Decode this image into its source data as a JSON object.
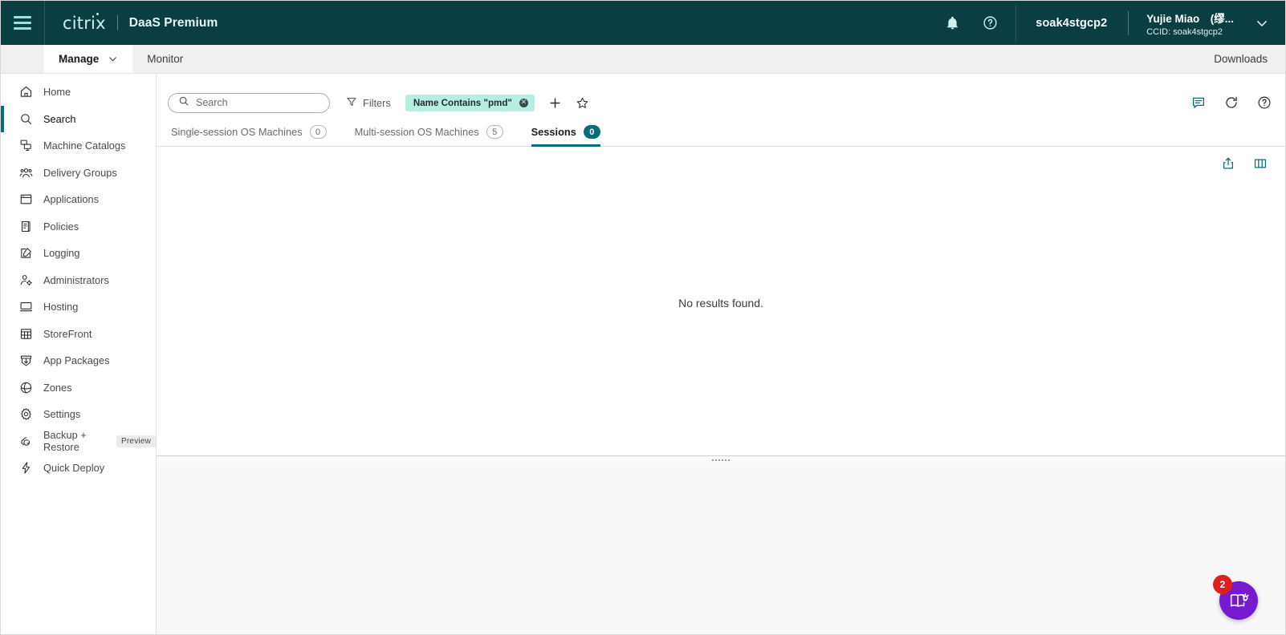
{
  "header": {
    "menu_icon": "hamburger-menu-icon",
    "logo_text": "citrix",
    "product_name": "DaaS Premium",
    "notifications_icon": "bell-icon",
    "help_icon": "help-circle-icon",
    "customer_name": "soak4stgcp2",
    "user_name": "Yujie Miao　(缪...",
    "user_ccid": "CCID: soak4stgcp2",
    "chevron_icon": "chevron-down-icon"
  },
  "navbar": {
    "tabs": [
      {
        "label": "Manage",
        "active": true,
        "has_chevron": true
      },
      {
        "label": "Monitor",
        "active": false,
        "has_chevron": false
      }
    ],
    "downloads_label": "Downloads"
  },
  "sidebar": {
    "items": [
      {
        "label": "Home",
        "icon": "home-icon",
        "selected": false
      },
      {
        "label": "Search",
        "icon": "search-icon",
        "selected": true
      },
      {
        "label": "Machine Catalogs",
        "icon": "machine-catalogs-icon",
        "selected": false
      },
      {
        "label": "Delivery Groups",
        "icon": "delivery-groups-icon",
        "selected": false
      },
      {
        "label": "Applications",
        "icon": "applications-icon",
        "selected": false
      },
      {
        "label": "Policies",
        "icon": "policies-icon",
        "selected": false
      },
      {
        "label": "Logging",
        "icon": "logging-icon",
        "selected": false
      },
      {
        "label": "Administrators",
        "icon": "administrators-icon",
        "selected": false
      },
      {
        "label": "Hosting",
        "icon": "hosting-icon",
        "selected": false
      },
      {
        "label": "StoreFront",
        "icon": "storefront-icon",
        "selected": false
      },
      {
        "label": "App Packages",
        "icon": "app-packages-icon",
        "selected": false
      },
      {
        "label": "Zones",
        "icon": "zones-icon",
        "selected": false
      },
      {
        "label": "Settings",
        "icon": "settings-gear-icon",
        "selected": false
      },
      {
        "label": "Backup + Restore",
        "icon": "backup-restore-icon",
        "selected": false,
        "badge": "Preview"
      },
      {
        "label": "Quick Deploy",
        "icon": "quick-deploy-bolt-icon",
        "selected": false
      }
    ]
  },
  "toolbar": {
    "search_placeholder": "Search",
    "search_value": "",
    "search_icon": "search-icon",
    "filters_label": "Filters",
    "filters_icon": "funnel-icon",
    "filter_chip": {
      "label": "Name Contains \"pmd\"",
      "remove_icon": "close-circle-icon"
    },
    "add_icon": "plus-icon",
    "favorite_icon": "star-outline-icon",
    "feedback_icon": "feedback-chat-icon",
    "refresh_icon": "refresh-icon",
    "help_icon": "help-circle-icon"
  },
  "tabs": [
    {
      "label": "Single-session OS Machines",
      "count": "0",
      "active": false
    },
    {
      "label": "Multi-session OS Machines",
      "count": "5",
      "active": false
    },
    {
      "label": "Sessions",
      "count": "0",
      "active": true
    }
  ],
  "results": {
    "export_icon": "export-upload-icon",
    "columns_icon": "columns-layout-icon",
    "empty_message": "No results found.",
    "splitter_icon": "drag-handle-dots"
  },
  "fab": {
    "icon": "guide-book-icon",
    "badge_count": "2"
  },
  "colors": {
    "header_bg": "#0B3E43",
    "accent_teal": "#0A6C79",
    "chip_bg": "#B6EEE4",
    "fab_purple": "#7719D1",
    "badge_red": "#E02020",
    "nav_bg": "#F0F0F0",
    "bottom_pane_bg": "#F8F8F8"
  }
}
